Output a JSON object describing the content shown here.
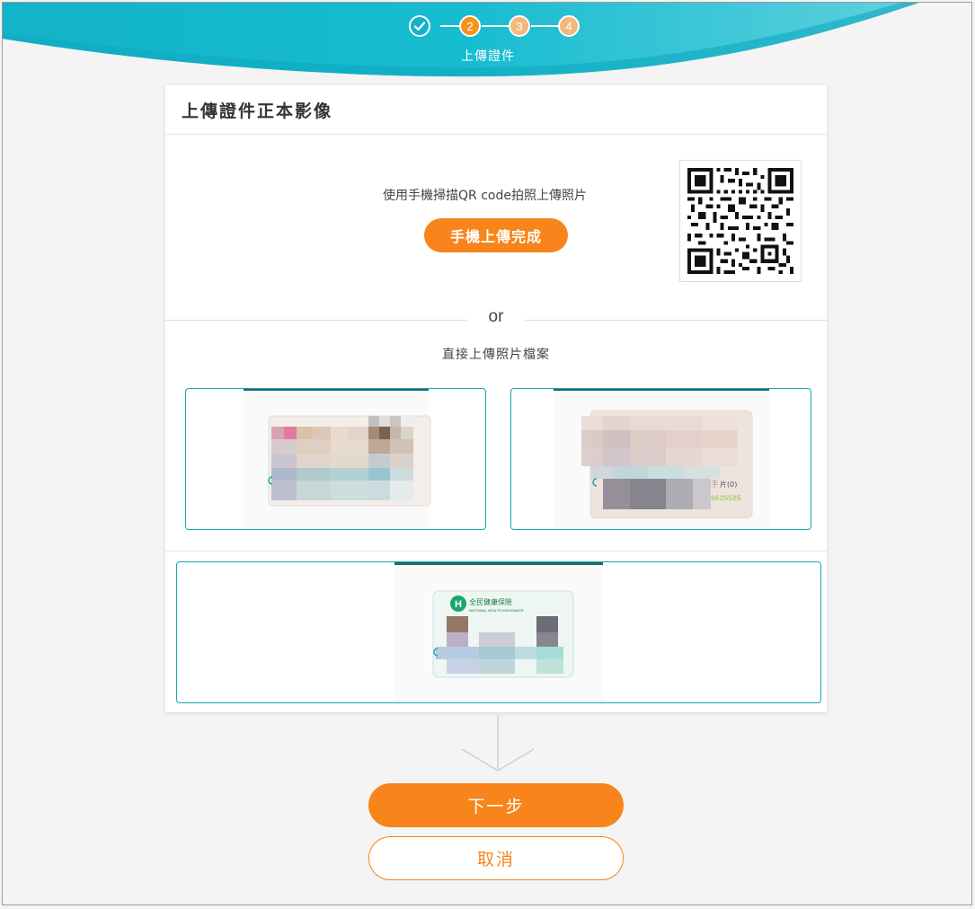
{
  "steps": {
    "items": [
      {
        "label": "",
        "state": "done"
      },
      {
        "label": "2",
        "state": "current"
      },
      {
        "label": "3",
        "state": "pending"
      },
      {
        "label": "4",
        "state": "pending"
      }
    ],
    "current_title": "上傳證件"
  },
  "card": {
    "title": "上傳證件正本影像",
    "qr_instruction": "使用手機掃描QR code拍照上傳照片",
    "mobile_done_label": "手機上傳完成",
    "or_text": "or",
    "direct_upload_label": "直接上傳照片檔案"
  },
  "uploads": [
    {
      "slot": "id-card-front",
      "status": "uploaded"
    },
    {
      "slot": "id-card-back",
      "status": "uploaded"
    },
    {
      "slot": "health-insurance-card",
      "status": "uploaded"
    }
  ],
  "health_card_text": {
    "cn": "全民健康保險",
    "en": "NATIONAL HEALTH INSURANCE"
  },
  "id_back_fragment": "9625505",
  "actions": {
    "next_label": "下一步",
    "cancel_label": "取消"
  },
  "colors": {
    "accent": "#f7851b",
    "teal": "#13b3c9",
    "upload_border": "#1aa6a6"
  },
  "icons": {
    "step_done": "check-icon",
    "flow_arrow": "chevron-down-icon"
  }
}
